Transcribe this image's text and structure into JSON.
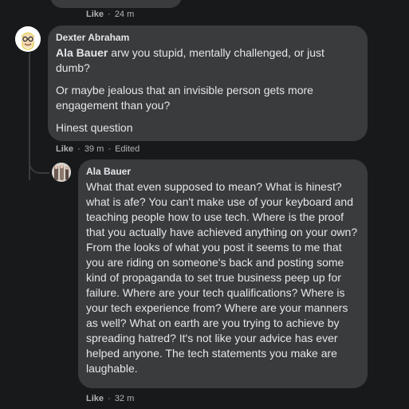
{
  "previous_comment": {
    "like_label": "Like",
    "time": "24 m"
  },
  "dexter_comment": {
    "author": "Dexter Abraham",
    "mention": "Ala Bauer",
    "line1_rest": " arw you stupid, mentally challenged, or just dumb?",
    "para2": "Or maybe jealous that an invisible person gets more engagement than you?",
    "para3": "Hinest question",
    "like_label": "Like",
    "time": "39 m",
    "edited": "Edited"
  },
  "ala_reply": {
    "author": "Ala Bauer",
    "text": "What that even supposed to mean? What is hinest? what is afe? You can't make use of your keyboard and teaching people how to use tech. Where is the proof that you actually have achieved anything on your own? From the looks of what you post it seems to me that you are riding on someone's back and posting some kind of propaganda to set true business peep up for failure. Where are your tech qualifications? Where is your tech experience from? Where are your manners as well? What on earth are you trying to achieve by spreading hatred? It's not like your advice has ever helped anyone. The tech statements you make are laughable.",
    "like_label": "Like",
    "time": "32 m"
  },
  "separator": "·",
  "colors": {
    "background": "#18191a",
    "bubble": "#3a3b3c",
    "text": "#e4e6eb",
    "meta": "#b0b3b8"
  }
}
